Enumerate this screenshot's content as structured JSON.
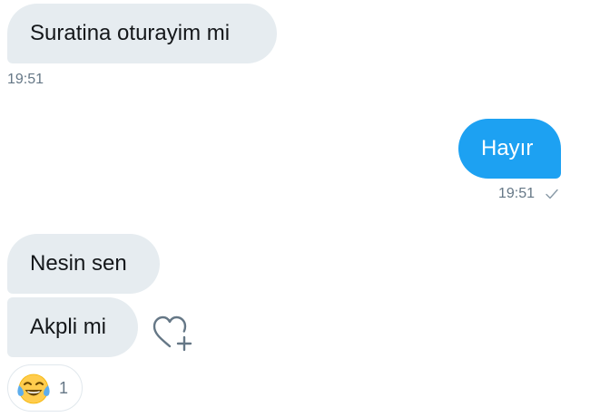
{
  "messages": [
    {
      "text": "Suratina oturayim mi",
      "direction": "incoming",
      "time": "19:51"
    },
    {
      "text": "Hayır",
      "direction": "outgoing",
      "time": "19:51",
      "read_status": "sent"
    },
    {
      "text": "Nesin sen",
      "direction": "incoming"
    },
    {
      "text": "Akpli mi",
      "direction": "incoming"
    }
  ],
  "reaction": {
    "emoji": "face-with-tears-of-joy",
    "count": "1"
  },
  "icons": {
    "add_reaction": "heart-plus-icon",
    "sent_check": "checkmark-icon"
  },
  "colors": {
    "incoming_bubble": "#e6ecf0",
    "outgoing_bubble": "#1da1f2",
    "timestamp": "#657786"
  }
}
